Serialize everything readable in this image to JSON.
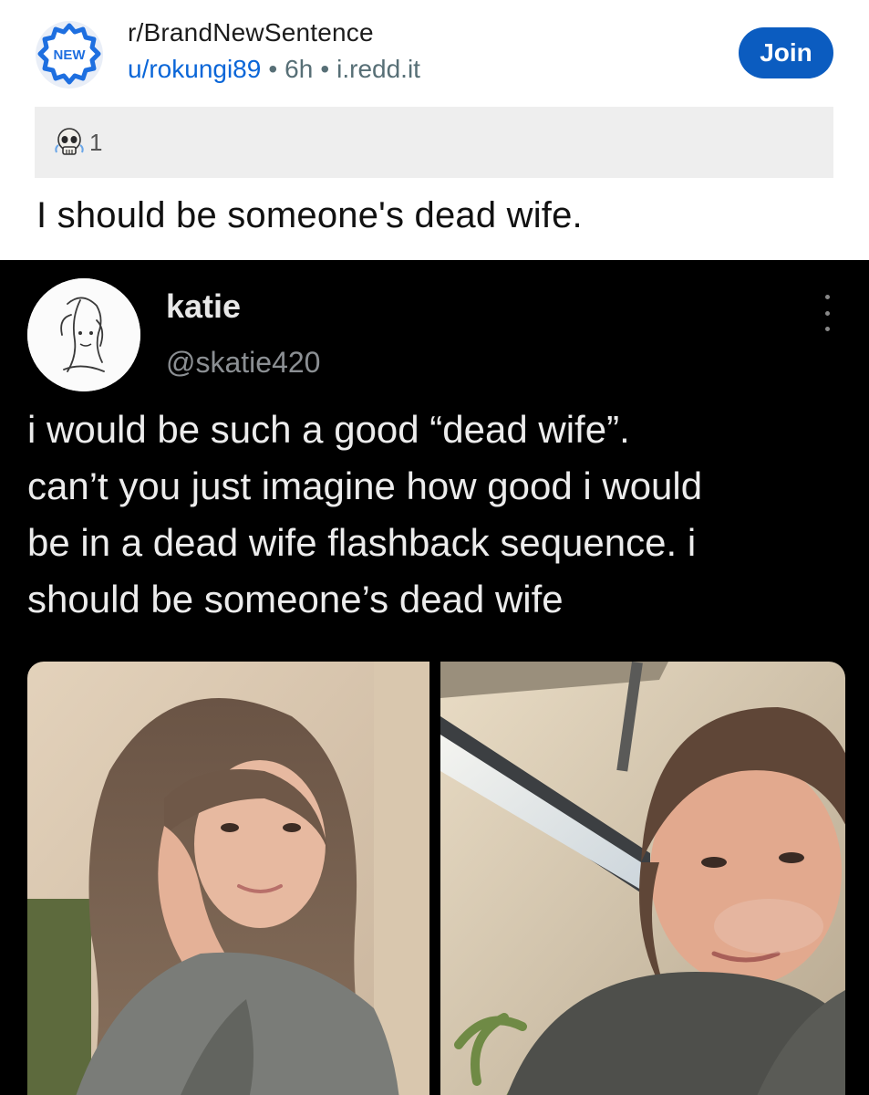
{
  "post": {
    "subreddit": "r/BrandNewSentence",
    "author": "u/rokungi89",
    "age": "6h",
    "domain": "i.redd.it",
    "join_label": "Join",
    "badge_text": "NEW",
    "award_count": "1",
    "title": "I should be someone's dead wife."
  },
  "tweet": {
    "name": "katie",
    "handle": "@skatie420",
    "lines": [
      "i would be such a good “dead wife”.",
      "can’t you just imagine how good i would",
      "be in a dead wife flashback sequence. i",
      "should be someone’s dead wife"
    ]
  },
  "colors": {
    "join_button": "#0b5cc0",
    "username_link": "#0a66d8",
    "badge": "#1e6fe0",
    "tweet_background": "#000000"
  },
  "icons": {
    "subreddit_avatar": "new-badge-icon",
    "award": "skull-award-icon",
    "menu": "more-vertical-icon"
  }
}
